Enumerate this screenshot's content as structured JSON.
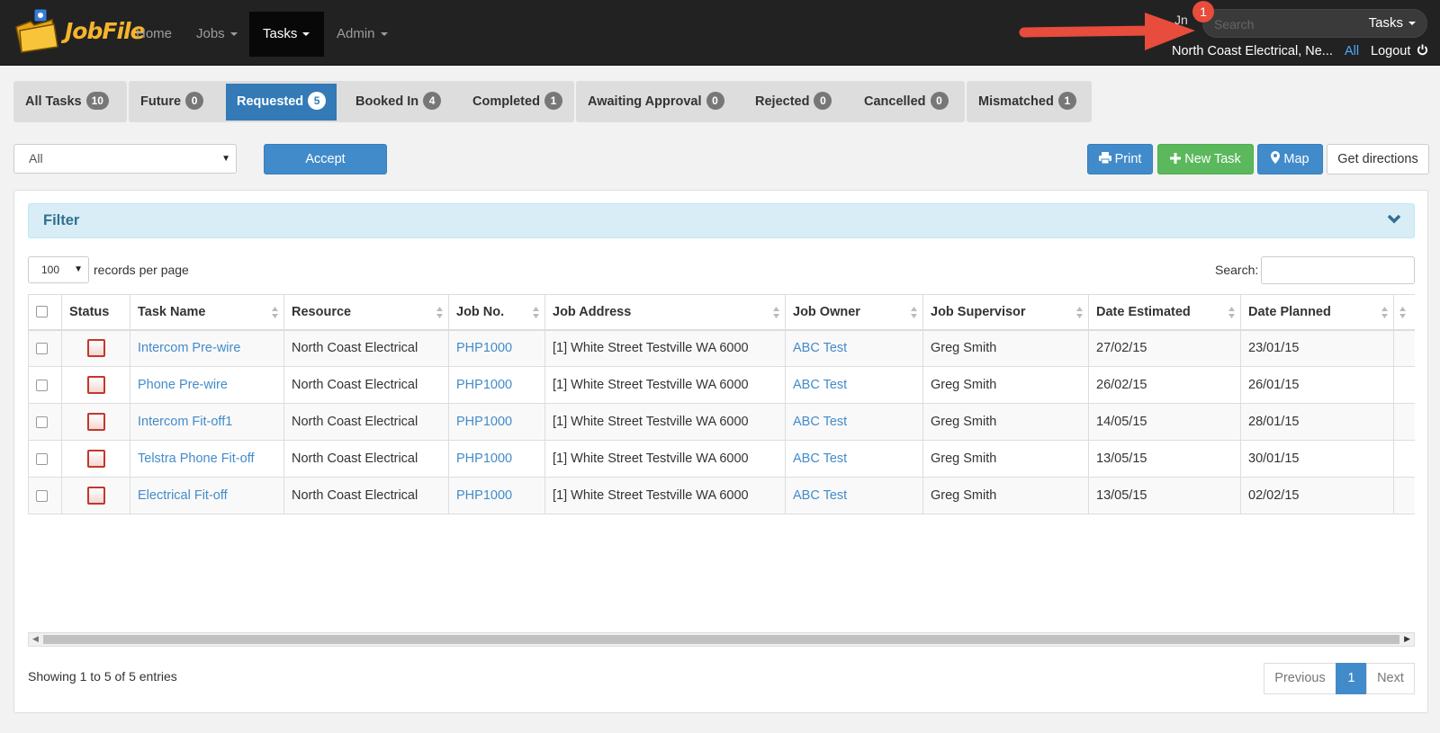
{
  "navbar": {
    "brand": "JobFile",
    "items": [
      {
        "label": "Home",
        "dropdown": false,
        "active": false
      },
      {
        "label": "Jobs",
        "dropdown": true,
        "active": false
      },
      {
        "label": "Tasks",
        "dropdown": true,
        "active": true
      },
      {
        "label": "Admin",
        "dropdown": true,
        "active": false
      }
    ],
    "search_placeholder": "Search",
    "search_scope": "Tasks",
    "partial_text": "Jn",
    "user_company": "North Coast Electrical, Ne...",
    "all_link": "All",
    "logout": "Logout",
    "notification_count": "1"
  },
  "tabs": [
    {
      "label": "All Tasks",
      "count": "10",
      "active": false
    },
    {
      "label": "Future",
      "count": "0",
      "active": false
    },
    {
      "label": "Requested",
      "count": "5",
      "active": true
    },
    {
      "label": "Booked In",
      "count": "4",
      "active": false
    },
    {
      "label": "Completed",
      "count": "1",
      "active": false
    },
    {
      "label": "Awaiting Approval",
      "count": "0",
      "active": false
    },
    {
      "label": "Rejected",
      "count": "0",
      "active": false
    },
    {
      "label": "Cancelled",
      "count": "0",
      "active": false
    },
    {
      "label": "Mismatched",
      "count": "1",
      "active": false
    }
  ],
  "controls": {
    "resource_select": "All",
    "accept": "Accept",
    "print": "Print",
    "new_task": "New Task",
    "map": "Map",
    "get_directions": "Get directions"
  },
  "filter": {
    "title": "Filter"
  },
  "table": {
    "per_page": "100",
    "per_page_label": "records per page",
    "search_label": "Search:",
    "columns": [
      "Status",
      "Task Name",
      "Resource",
      "Job No.",
      "Job Address",
      "Job Owner",
      "Job Supervisor",
      "Date Estimated",
      "Date Planned"
    ],
    "rows": [
      {
        "task": "Intercom Pre-wire",
        "resource": "North Coast Electrical",
        "job_no": "PHP1000",
        "address": "[1] White Street Testville WA 6000",
        "owner": "ABC Test",
        "supervisor": "Greg Smith",
        "estimated": "27/02/15",
        "planned": "23/01/15"
      },
      {
        "task": "Phone Pre-wire",
        "resource": "North Coast Electrical",
        "job_no": "PHP1000",
        "address": "[1] White Street Testville WA 6000",
        "owner": "ABC Test",
        "supervisor": "Greg Smith",
        "estimated": "26/02/15",
        "planned": "26/01/15"
      },
      {
        "task": "Intercom Fit-off1",
        "resource": "North Coast Electrical",
        "job_no": "PHP1000",
        "address": "[1] White Street Testville WA 6000",
        "owner": "ABC Test",
        "supervisor": "Greg Smith",
        "estimated": "14/05/15",
        "planned": "28/01/15"
      },
      {
        "task": "Telstra Phone Fit-off",
        "resource": "North Coast Electrical",
        "job_no": "PHP1000",
        "address": "[1] White Street Testville WA 6000",
        "owner": "ABC Test",
        "supervisor": "Greg Smith",
        "estimated": "13/05/15",
        "planned": "30/01/15"
      },
      {
        "task": "Electrical Fit-off",
        "resource": "North Coast Electrical",
        "job_no": "PHP1000",
        "address": "[1] White Street Testville WA 6000",
        "owner": "ABC Test",
        "supervisor": "Greg Smith",
        "estimated": "13/05/15",
        "planned": "02/02/15"
      }
    ]
  },
  "footer": {
    "showing": "Showing 1 to 5 of 5 entries",
    "previous": "Previous",
    "page": "1",
    "next": "Next"
  },
  "colors": {
    "navbar_bg": "#222222",
    "primary": "#428bca",
    "success": "#5cb85c",
    "notification": "#e74c3c",
    "brand": "#f5b52b"
  }
}
